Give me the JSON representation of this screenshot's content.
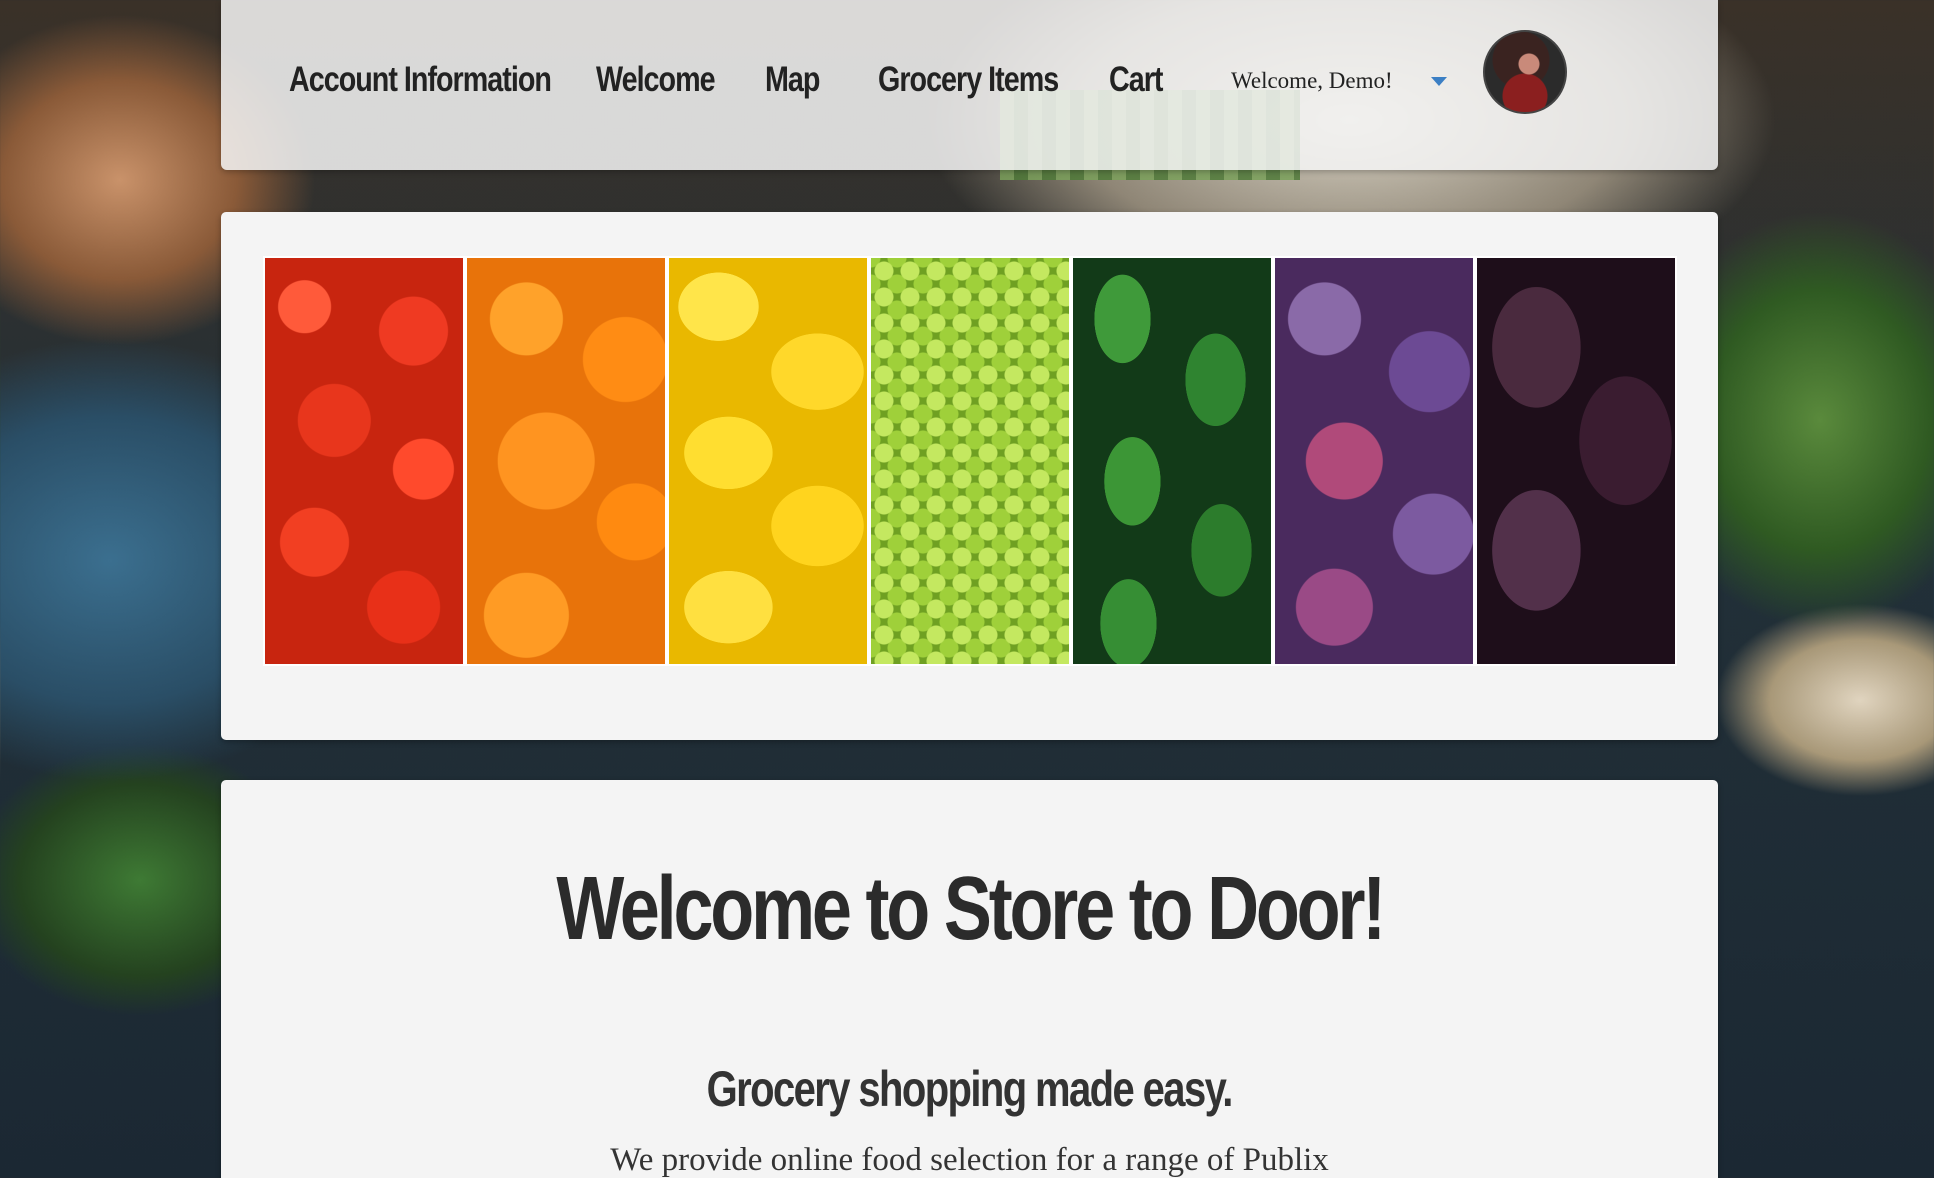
{
  "nav": {
    "links": [
      {
        "label": "Account Information"
      },
      {
        "label": "Welcome"
      },
      {
        "label": "Map"
      },
      {
        "label": "Grocery Items"
      },
      {
        "label": "Cart"
      }
    ],
    "user_greeting": "Welcome, Demo!",
    "caret_icon": "caret-down-icon",
    "accent_color": "#3b7fc4"
  },
  "banner": {
    "panels": [
      "tomatoes",
      "oranges",
      "lemons",
      "grapes",
      "cucumbers",
      "plums",
      "eggplants"
    ]
  },
  "welcome": {
    "title": "Welcome to Store to Door!",
    "subtitle": "Grocery shopping made easy.",
    "body": "We provide online food selection for a range of Publix"
  }
}
